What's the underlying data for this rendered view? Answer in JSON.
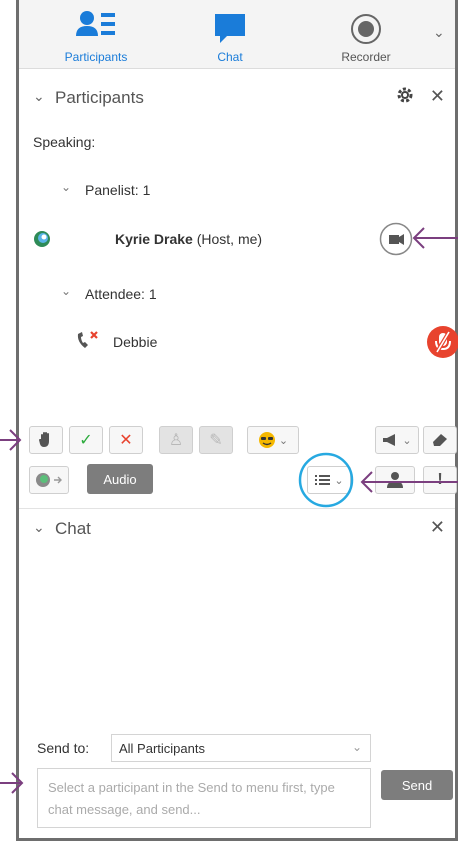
{
  "tabs": {
    "participants": "Participants",
    "chat": "Chat",
    "recorder": "Recorder"
  },
  "participants_panel": {
    "title": "Participants",
    "speaking": "Speaking:",
    "panelist_group": "Panelist: 1",
    "host_name": "Kyrie Drake",
    "host_role": "(Host, me)",
    "attendee_group": "Attendee: 1",
    "attendee_name": "Debbie"
  },
  "controls": {
    "audio_label": "Audio"
  },
  "chat_panel": {
    "title": "Chat",
    "send_to_label": "Send to:",
    "send_to_value": "All Participants",
    "message_placeholder": "Select a participant in the Send to menu first, type chat message, and send...",
    "send_label": "Send"
  },
  "colors": {
    "brand_blue": "#1a7cd9",
    "annotation_purple": "#7b3f7f",
    "highlight_cyan": "#27a9e1",
    "mute_red": "#e8432e"
  }
}
